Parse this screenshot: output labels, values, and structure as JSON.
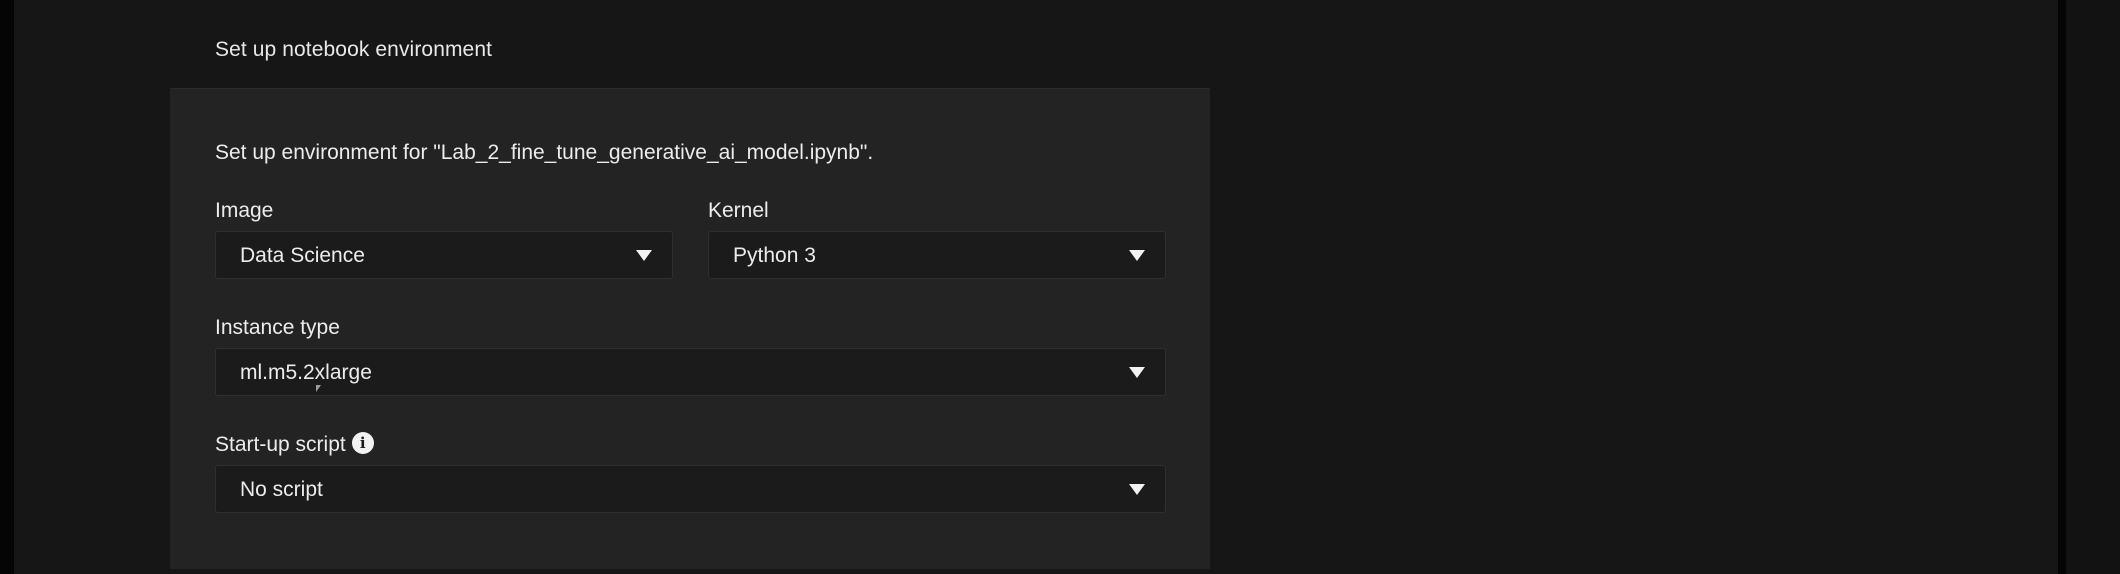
{
  "section": {
    "title": "Set up notebook environment"
  },
  "panel": {
    "description": "Set up environment for \"Lab_2_fine_tune_generative_ai_model.ipynb\".",
    "image": {
      "label": "Image",
      "value": "Data Science"
    },
    "kernel": {
      "label": "Kernel",
      "value": "Python 3"
    },
    "instance_type": {
      "label": "Instance type",
      "value": "ml.m5.2xlarge"
    },
    "startup_script": {
      "label": "Start-up script",
      "value": "No script",
      "info_icon": "info-icon"
    }
  },
  "colors": {
    "background": "#161616",
    "panel": "#232323",
    "select_bg": "#1b1b1b",
    "text": "#ececec"
  }
}
